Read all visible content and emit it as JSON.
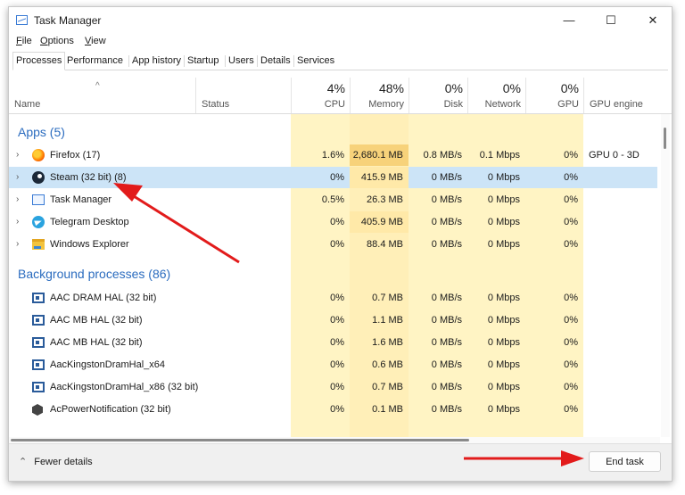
{
  "window": {
    "title": "Task Manager",
    "minimize": "—",
    "maximize": "☐",
    "close": "✕"
  },
  "menu": [
    {
      "key": "F",
      "rest": "ile"
    },
    {
      "key": "O",
      "rest": "ptions"
    },
    {
      "key": "V",
      "rest": "iew"
    }
  ],
  "tabs": [
    "Processes",
    "Performance",
    "App history",
    "Startup",
    "Users",
    "Details",
    "Services"
  ],
  "columns": {
    "name": "Name",
    "status": "Status",
    "cpu": {
      "pct": "4%",
      "label": "CPU"
    },
    "memory": {
      "pct": "48%",
      "label": "Memory"
    },
    "disk": {
      "pct": "0%",
      "label": "Disk"
    },
    "network": {
      "pct": "0%",
      "label": "Network"
    },
    "gpu": {
      "pct": "0%",
      "label": "GPU"
    },
    "gpu_engine": "GPU engine"
  },
  "groups": {
    "apps": "Apps (5)",
    "background": "Background processes (86)"
  },
  "apps": [
    {
      "name": "Firefox (17)",
      "icon": "firefox-icon",
      "cpu": "1.6%",
      "mem": "2,680.1 MB",
      "disk": "0.8 MB/s",
      "net": "0.1 Mbps",
      "gpu": "0%",
      "engine": "GPU 0 - 3D"
    },
    {
      "name": "Steam (32 bit) (8)",
      "icon": "steam-icon",
      "cpu": "0%",
      "mem": "415.9 MB",
      "disk": "0 MB/s",
      "net": "0 Mbps",
      "gpu": "0%",
      "engine": ""
    },
    {
      "name": "Task Manager",
      "icon": "task-manager-icon",
      "cpu": "0.5%",
      "mem": "26.3 MB",
      "disk": "0 MB/s",
      "net": "0 Mbps",
      "gpu": "0%",
      "engine": ""
    },
    {
      "name": "Telegram Desktop",
      "icon": "telegram-icon",
      "cpu": "0%",
      "mem": "405.9 MB",
      "disk": "0 MB/s",
      "net": "0 Mbps",
      "gpu": "0%",
      "engine": ""
    },
    {
      "name": "Windows Explorer",
      "icon": "folder-icon",
      "cpu": "0%",
      "mem": "88.4 MB",
      "disk": "0 MB/s",
      "net": "0 Mbps",
      "gpu": "0%",
      "engine": ""
    }
  ],
  "background": [
    {
      "name": "AAC DRAM HAL (32 bit)",
      "icon": "service-icon",
      "cpu": "0%",
      "mem": "0.7 MB",
      "disk": "0 MB/s",
      "net": "0 Mbps",
      "gpu": "0%"
    },
    {
      "name": "AAC MB HAL (32 bit)",
      "icon": "service-icon",
      "cpu": "0%",
      "mem": "1.1 MB",
      "disk": "0 MB/s",
      "net": "0 Mbps",
      "gpu": "0%"
    },
    {
      "name": "AAC MB HAL (32 bit)",
      "icon": "service-icon",
      "cpu": "0%",
      "mem": "1.6 MB",
      "disk": "0 MB/s",
      "net": "0 Mbps",
      "gpu": "0%"
    },
    {
      "name": "AacKingstonDramHal_x64",
      "icon": "service-icon",
      "cpu": "0%",
      "mem": "0.6 MB",
      "disk": "0 MB/s",
      "net": "0 Mbps",
      "gpu": "0%"
    },
    {
      "name": "AacKingstonDramHal_x86 (32 bit)",
      "icon": "service-icon",
      "cpu": "0%",
      "mem": "0.7 MB",
      "disk": "0 MB/s",
      "net": "0 Mbps",
      "gpu": "0%"
    },
    {
      "name": "AcPowerNotification (32 bit)",
      "icon": "hexagon-icon",
      "cpu": "0%",
      "mem": "0.1 MB",
      "disk": "0 MB/s",
      "net": "0 Mbps",
      "gpu": "0%"
    }
  ],
  "footer": {
    "fewer_details": "Fewer details",
    "end_task": "End task"
  },
  "colors": {
    "accent": "#2b6cbf",
    "selected_row": "#cce4f7",
    "heat_light": "#fff4c4",
    "heat_mid": "#ffe9a8",
    "heat_strong": "#f7d27a",
    "annotation_arrow": "#e21b1b"
  }
}
